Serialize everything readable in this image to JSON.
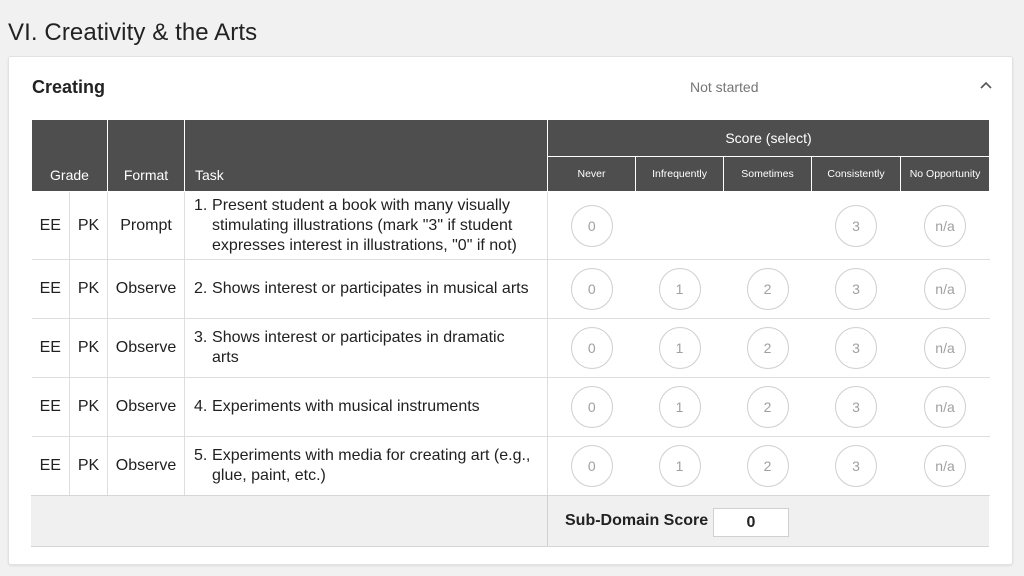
{
  "section": {
    "title": "VI. Creativity & the Arts"
  },
  "card": {
    "title": "Creating",
    "status": "Not started",
    "collapse_icon": "chevron-up-icon"
  },
  "table": {
    "headers": {
      "grade": "Grade",
      "format": "Format",
      "task": "Task",
      "score": "Score (select)",
      "score_options": [
        "Never",
        "Infrequently",
        "Sometimes",
        "Consistently",
        "No Opportunity"
      ]
    },
    "rows": [
      {
        "grade": "EE",
        "level": "PK",
        "format": "Prompt",
        "num": "1.",
        "task": "Present student a book with many visually stimulating illustrations (mark \"3\" if student expresses interest in illustrations, \"0\" if not)",
        "scores": [
          "0",
          "",
          "",
          "3",
          "n/a"
        ]
      },
      {
        "grade": "EE",
        "level": "PK",
        "format": "Observe",
        "num": "2.",
        "task": "Shows interest or participates in musical arts",
        "scores": [
          "0",
          "1",
          "2",
          "3",
          "n/a"
        ]
      },
      {
        "grade": "EE",
        "level": "PK",
        "format": "Observe",
        "num": "3.",
        "task": "Shows interest or participates in dramatic arts",
        "scores": [
          "0",
          "1",
          "2",
          "3",
          "n/a"
        ]
      },
      {
        "grade": "EE",
        "level": "PK",
        "format": "Observe",
        "num": "4.",
        "task": "Experiments with musical instruments",
        "scores": [
          "0",
          "1",
          "2",
          "3",
          "n/a"
        ]
      },
      {
        "grade": "EE",
        "level": "PK",
        "format": "Observe",
        "num": "5.",
        "task": "Experiments with media for creating art (e.g., glue, paint, etc.)",
        "scores": [
          "0",
          "1",
          "2",
          "3",
          "n/a"
        ]
      }
    ]
  },
  "footer": {
    "subdomain_label": "Sub-Domain Score",
    "subdomain_value": "0"
  }
}
